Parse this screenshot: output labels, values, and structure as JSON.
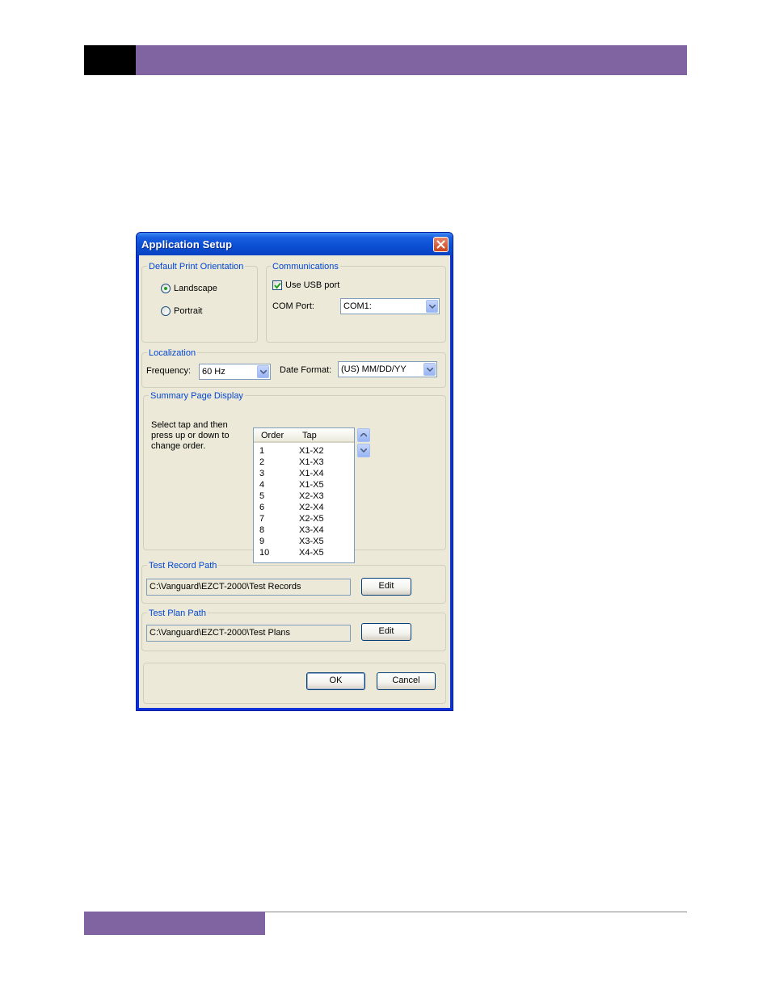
{
  "colors": {
    "accent": "#8064a2",
    "title_bar": "#0a4ed3",
    "group_title": "#0046d5"
  },
  "dialog": {
    "title": "Application Setup",
    "close_icon": "close-icon"
  },
  "print_orientation": {
    "title": "Default Print Orientation",
    "options": [
      {
        "label": "Landscape",
        "selected": true
      },
      {
        "label": "Portrait",
        "selected": false
      }
    ]
  },
  "communications": {
    "title": "Communications",
    "use_usb_label": "Use USB port",
    "use_usb_checked": true,
    "com_port_label": "COM Port:",
    "com_port_value": "COM1:"
  },
  "localization": {
    "title": "Localization",
    "frequency_label": "Frequency:",
    "frequency_value": "60 Hz",
    "date_format_label": "Date Format:",
    "date_format_value": "(US) MM/DD/YY"
  },
  "summary": {
    "title": "Summary Page Display",
    "instructions": "Select tap and then\npress up or down to\nchange order.",
    "columns": {
      "order": "Order",
      "tap": "Tap"
    },
    "rows": [
      {
        "order": "1",
        "tap": "X1-X2"
      },
      {
        "order": "2",
        "tap": "X1-X3"
      },
      {
        "order": "3",
        "tap": "X1-X4"
      },
      {
        "order": "4",
        "tap": "X1-X5"
      },
      {
        "order": "5",
        "tap": "X2-X3"
      },
      {
        "order": "6",
        "tap": "X2-X4"
      },
      {
        "order": "7",
        "tap": "X2-X5"
      },
      {
        "order": "8",
        "tap": "X3-X4"
      },
      {
        "order": "9",
        "tap": "X3-X5"
      },
      {
        "order": "10",
        "tap": "X4-X5"
      }
    ]
  },
  "test_record": {
    "title": "Test Record Path",
    "path": "C:\\Vanguard\\EZCT-2000\\Test Records",
    "edit_label": "Edit"
  },
  "test_plan": {
    "title": "Test  Plan Path",
    "path": "C:\\Vanguard\\EZCT-2000\\Test Plans",
    "edit_label": "Edit"
  },
  "footer": {
    "ok_label": "OK",
    "cancel_label": "Cancel"
  }
}
